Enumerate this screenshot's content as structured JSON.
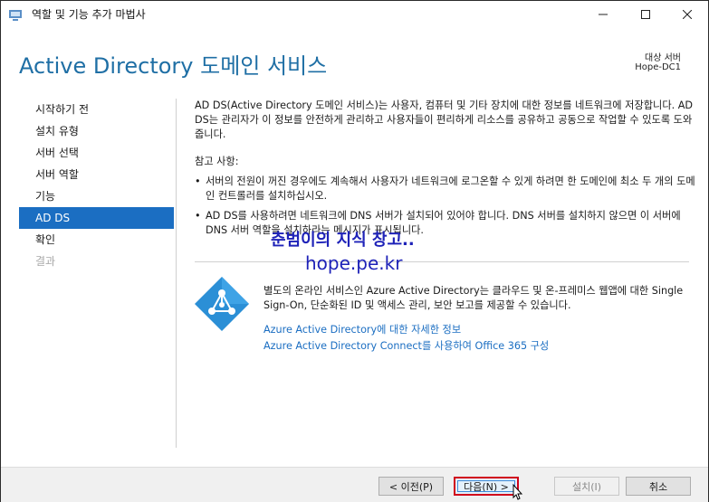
{
  "window": {
    "title": "역할 및 기능 추가 마법사"
  },
  "header": {
    "title": "Active Directory 도메인 서비스",
    "target_label": "대상 서버",
    "target_name": "Hope-DC1"
  },
  "sidebar": {
    "items": [
      {
        "label": "시작하기 전"
      },
      {
        "label": "설치 유형"
      },
      {
        "label": "서버 선택"
      },
      {
        "label": "서버 역할"
      },
      {
        "label": "기능"
      },
      {
        "label": "AD DS"
      },
      {
        "label": "확인"
      },
      {
        "label": "결과"
      }
    ],
    "active_index": 5
  },
  "content": {
    "intro": "AD DS(Active Directory 도메인 서비스)는 사용자, 컴퓨터 및 기타 장치에 대한 정보를 네트워크에 저장합니다. AD DS는 관리자가 이 정보를 안전하게 관리하고 사용자들이 편리하게 리소스를 공유하고 공동으로 작업할 수 있도록 도와줍니다.",
    "notes_title": "참고 사항:",
    "notes": [
      "서버의 전원이 꺼진 경우에도 계속해서 사용자가 네트워크에 로그온할 수 있게 하려면 한 도메인에 최소 두 개의 도메인 컨트롤러를 설치하십시오.",
      "AD DS를 사용하려면 네트워크에 DNS 서버가 설치되어 있어야 합니다. DNS 서버를 설치하지 않으면 이 서버에 DNS 서버 역할을 설치하라는 메시지가 표시됩니다."
    ],
    "azure_text": "별도의 온라인 서비스인 Azure Active Directory는 클라우드 및 온-프레미스 웹앱에 대한 Single Sign-On, 단순화된 ID 및 액세스 관리, 보안 보고를 제공할 수 있습니다.",
    "link1": "Azure Active Directory에 대한 자세한 정보",
    "link2": "Azure Active Directory Connect를 사용하여 Office 365 구성"
  },
  "watermark": {
    "line1": "춘범이의 지식 창고..",
    "line2": "hope.pe.kr"
  },
  "footer": {
    "prev": "< 이전(P)",
    "next": "다음(N) >",
    "install": "설치(I)",
    "cancel": "취소"
  },
  "colors": {
    "accent": "#1b6ec2",
    "title": "#1f6fa5",
    "highlight_border": "#d0021b"
  },
  "icons": {
    "app": "server-manager-icon",
    "azure": "azure-ad-icon"
  }
}
